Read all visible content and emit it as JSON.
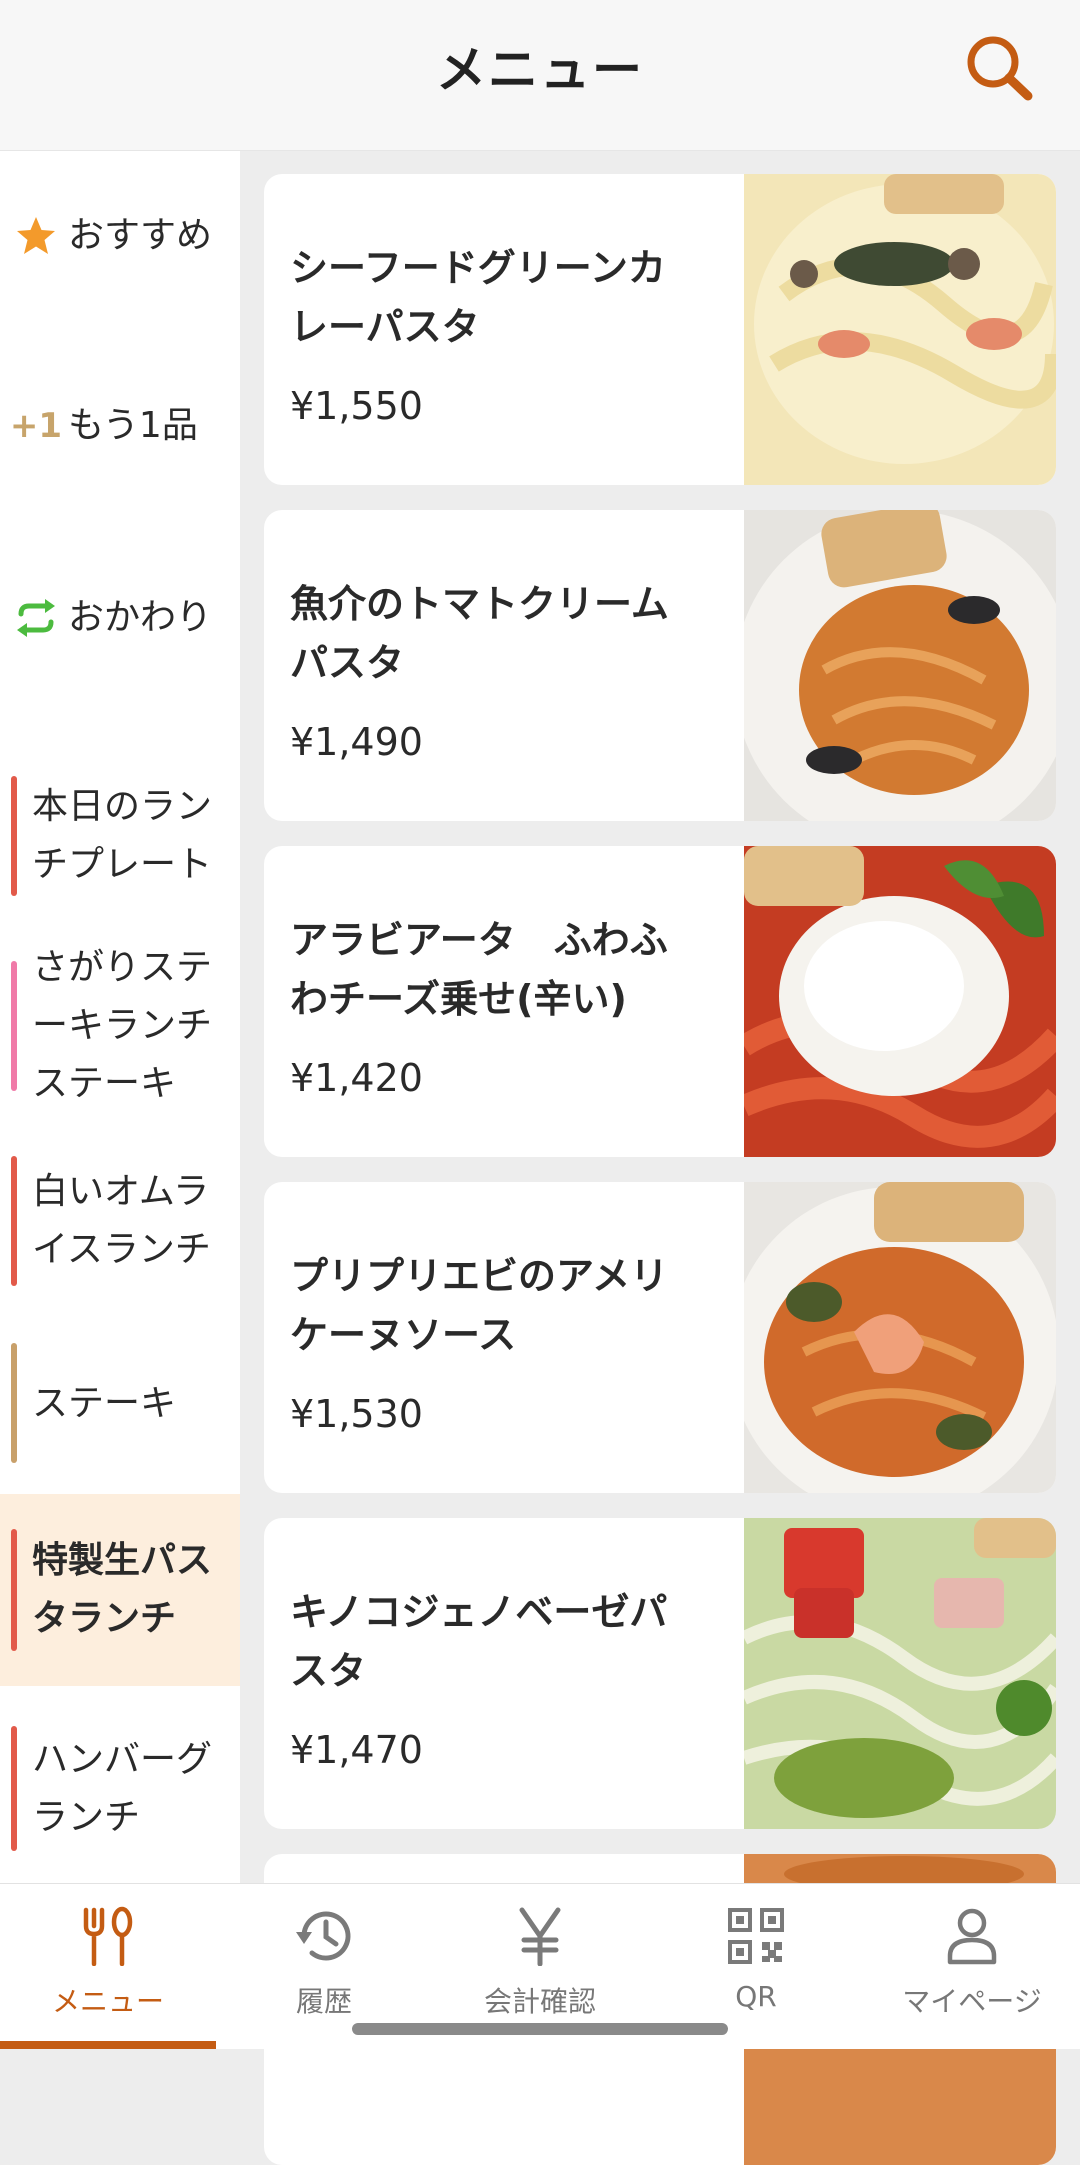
{
  "header": {
    "title": "メニュー"
  },
  "sidebar": {
    "special": [
      {
        "label": "おすすめ",
        "icon": "star-icon",
        "color": "#f39a2b"
      },
      {
        "label": "もう1品",
        "icon": "plus-one-icon",
        "icon_text": "+1",
        "color": "#c7a46b"
      },
      {
        "label": "おかわり",
        "icon": "refresh-icon",
        "color": "#4cbb3f"
      }
    ],
    "categories": [
      {
        "label": "本日のランチプレート",
        "bar_color": "#e25a4a",
        "active": false
      },
      {
        "label": "さがりステーキランチステーキ",
        "bar_color": "#f07aa8",
        "active": false
      },
      {
        "label": "白いオムライスランチ",
        "bar_color": "#e25a4a",
        "active": false
      },
      {
        "label": "ステーキ",
        "bar_color": "#c8a06a",
        "active": false
      },
      {
        "label": "特製生パスタランチ",
        "bar_color": "#e25a4a",
        "active": true
      },
      {
        "label": "ハンバーグランチ",
        "bar_color": "#e25a4a",
        "active": false
      }
    ]
  },
  "menu_items": [
    {
      "name": "シーフードグリーンカレーパスタ",
      "price": "¥1,550",
      "sauce": "#f1e4b4"
    },
    {
      "name": "魚介のトマトクリームパスタ",
      "price": "¥1,490",
      "sauce": "#d97a2e"
    },
    {
      "name": "アラビアータ　ふわふわチーズ乗せ(辛い)",
      "price": "¥1,420",
      "sauce": "#d9462a"
    },
    {
      "name": "プリプリエビのアメリケーヌソース",
      "price": "¥1,530",
      "sauce": "#d46a2c"
    },
    {
      "name": "キノコジェノベーゼパスタ",
      "price": "¥1,470",
      "sauce": "#8fb24a"
    }
  ],
  "tabbar": {
    "items": [
      {
        "label": "メニュー",
        "icon": "fork-spoon-icon",
        "active": true
      },
      {
        "label": "履歴",
        "icon": "history-icon",
        "active": false
      },
      {
        "label": "会計確認",
        "icon": "yen-icon",
        "active": false
      },
      {
        "label": "QR",
        "icon": "qr-code-icon",
        "active": false
      },
      {
        "label": "マイページ",
        "icon": "user-icon",
        "active": false
      }
    ]
  },
  "colors": {
    "accent": "#c45c13",
    "active_bg": "#fdeedd"
  }
}
